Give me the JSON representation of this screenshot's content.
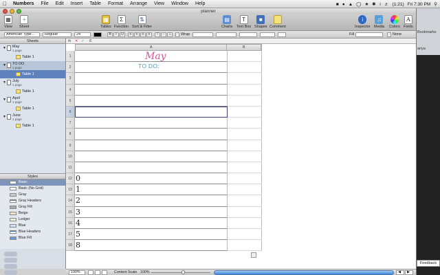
{
  "menubar": {
    "app": "Numbers",
    "items": [
      "File",
      "Edit",
      "Insert",
      "Table",
      "Format",
      "Arrange",
      "View",
      "Window",
      "Help"
    ],
    "status_right": {
      "battery": "(1:21)",
      "clock": "Fri 7:30 PM"
    }
  },
  "window": {
    "title": "planner"
  },
  "toolbar": {
    "left": [
      {
        "label": "View",
        "icon": "view-icon"
      },
      {
        "label": "Sheet",
        "icon": "sheet-icon"
      },
      {
        "label": "Tables",
        "icon": "tables-icon"
      },
      {
        "label": "Function",
        "icon": "function-icon"
      },
      {
        "label": "Sort & Filter",
        "icon": "sort-filter-icon"
      }
    ],
    "right": [
      {
        "label": "Charts",
        "icon": "charts-icon"
      },
      {
        "label": "Text Box",
        "icon": "textbox-icon"
      },
      {
        "label": "Shapes",
        "icon": "shapes-icon"
      },
      {
        "label": "Comment",
        "icon": "comment-icon"
      },
      {
        "label": "Inspector",
        "icon": "inspector-icon"
      },
      {
        "label": "Media",
        "icon": "media-icon"
      },
      {
        "label": "Colors",
        "icon": "colors-icon"
      },
      {
        "label": "Fonts",
        "icon": "fonts-icon"
      }
    ]
  },
  "format_bar": {
    "font_family": "American Type...",
    "font_style": "Regular",
    "font_size": "24",
    "wrap_label": "Wrap",
    "fill_label": "Fill",
    "none_label": "None"
  },
  "formula_bar": {
    "fx": "fx",
    "value": "6"
  },
  "sheets_pane": {
    "header": "Sheets",
    "sheets": [
      {
        "name": "May",
        "pages": "1 page",
        "table": "Table 1"
      },
      {
        "name": "TO DO",
        "pages": "1 page",
        "table": "Table 1"
      },
      {
        "name": "July",
        "pages": "1 page",
        "table": "Table 1"
      },
      {
        "name": "April",
        "pages": "1 page",
        "table": "Table 1"
      },
      {
        "name": "June",
        "pages": "1 page",
        "table": "Table 1"
      }
    ]
  },
  "styles_pane": {
    "header": "Styles",
    "items": [
      "Basic",
      "Basic (No Grid)",
      "Gray",
      "Gray Headers",
      "Gray Fill",
      "Beige",
      "Ledger",
      "Blue",
      "Blue Headers",
      "Blue Fill"
    ]
  },
  "table": {
    "columns": [
      "A",
      "B"
    ],
    "rows": [
      "1",
      "2",
      "3",
      "4",
      "5",
      "6",
      "7",
      "8",
      "9",
      "10",
      "11",
      "12",
      "13",
      "14",
      "15",
      "16",
      "17",
      "18"
    ],
    "title": "May",
    "subtitle": "TO DO:",
    "row_glyphs": {
      "12": "0",
      "13": "1",
      "14": "2",
      "15": "3",
      "16": "4",
      "17": "5",
      "18": "8"
    }
  },
  "statusbar": {
    "zoom": "100%",
    "content_scale_label": "Content Scale",
    "content_scale": "100%"
  },
  "background_app": {
    "bookmarks": "Bookmarks",
    "name": "anya",
    "feedback": "Feedback"
  }
}
